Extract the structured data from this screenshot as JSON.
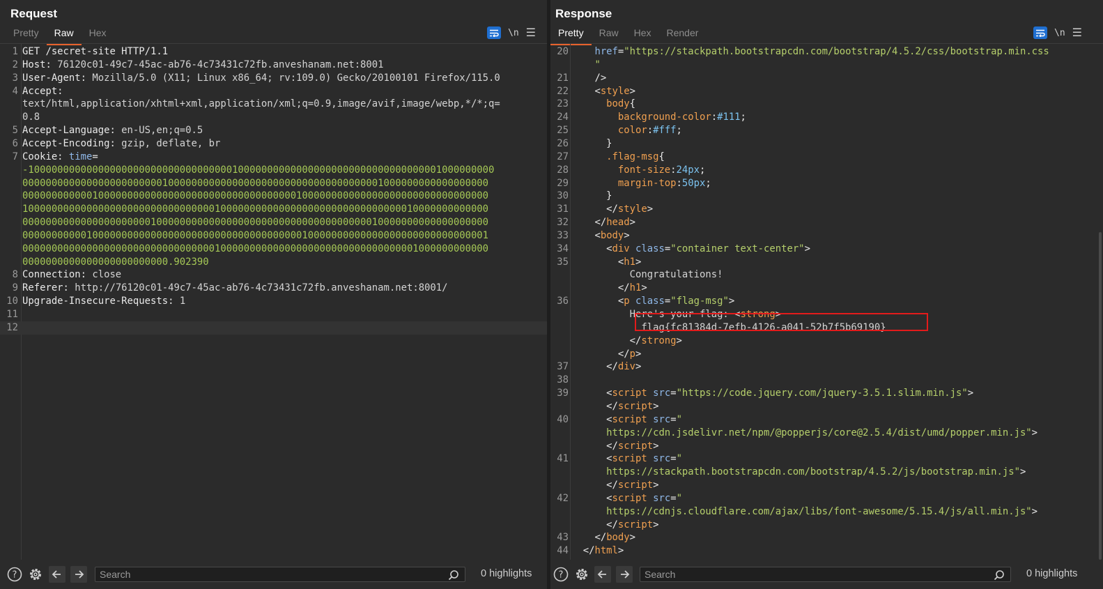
{
  "request": {
    "title": "Request",
    "tabs": [
      {
        "label": "Pretty"
      },
      {
        "label": "Raw"
      },
      {
        "label": "Hex"
      }
    ],
    "active_tab": "Raw",
    "newline_label": "\\n",
    "lines": [
      {
        "n": "1",
        "parts": [
          {
            "c": "k",
            "t": "GET /secret-site HTTP/1.1"
          }
        ]
      },
      {
        "n": "2",
        "parts": [
          {
            "c": "k",
            "t": "Host: "
          },
          {
            "c": "v",
            "t": "76120c01-49c7-45ac-ab76-4c73431c72fb.anveshanam.net:8001"
          }
        ]
      },
      {
        "n": "3",
        "parts": [
          {
            "c": "k",
            "t": "User-Agent: "
          },
          {
            "c": "v",
            "t": "Mozilla/5.0 (X11; Linux x86_64; rv:109.0) Gecko/20100101 Firefox/115.0"
          }
        ]
      },
      {
        "n": "4",
        "parts": [
          {
            "c": "k",
            "t": "Accept: "
          }
        ]
      },
      {
        "n": "",
        "parts": [
          {
            "c": "v",
            "t": "text/html,application/xhtml+xml,application/xml;q=0.9,image/avif,image/webp,*/*;q="
          }
        ]
      },
      {
        "n": "",
        "parts": [
          {
            "c": "v",
            "t": "0.8"
          }
        ]
      },
      {
        "n": "5",
        "parts": [
          {
            "c": "k",
            "t": "Accept-Language: "
          },
          {
            "c": "v",
            "t": "en-US,en;q=0.5"
          }
        ]
      },
      {
        "n": "6",
        "parts": [
          {
            "c": "k",
            "t": "Accept-Encoding: "
          },
          {
            "c": "v",
            "t": "gzip, deflate, br"
          }
        ]
      },
      {
        "n": "7",
        "parts": [
          {
            "c": "k",
            "t": "Cookie: "
          },
          {
            "c": "a",
            "t": "time"
          },
          {
            "c": "k",
            "t": "="
          }
        ]
      },
      {
        "n": "",
        "parts": [
          {
            "c": "g",
            "t": "-10000000000000000000000000000000000100000000000000000000000000000000001000000000"
          }
        ]
      },
      {
        "n": "",
        "parts": [
          {
            "c": "g",
            "t": "00000000000000000000000010000000000000000000000000000000000001000000000000000000"
          }
        ]
      },
      {
        "n": "",
        "parts": [
          {
            "c": "g",
            "t": "00000000000010000000000000000000000000000000000100000000000000000000000000000000"
          }
        ]
      },
      {
        "n": "",
        "parts": [
          {
            "c": "g",
            "t": "10000000000000000000000000000000010000000000000000000000000000000010000000000000"
          }
        ]
      },
      {
        "n": "",
        "parts": [
          {
            "c": "g",
            "t": "00000000000000000000001000000000000000000000000000000000000010000000000000000000"
          }
        ]
      },
      {
        "n": "",
        "parts": [
          {
            "c": "g",
            "t": "00000000000100000000000000000000000000000000000010000000000000000000000000000001"
          }
        ]
      },
      {
        "n": "",
        "parts": [
          {
            "c": "g",
            "t": "00000000000000000000000000000000010000000000000000000000000000000001000000000000"
          }
        ]
      },
      {
        "n": "",
        "parts": [
          {
            "c": "g",
            "t": "0000000000000000000000000.902390"
          }
        ]
      },
      {
        "n": "8",
        "parts": [
          {
            "c": "k",
            "t": "Connection: "
          },
          {
            "c": "v",
            "t": "close"
          }
        ]
      },
      {
        "n": "9",
        "parts": [
          {
            "c": "k",
            "t": "Referer: "
          },
          {
            "c": "v",
            "t": "http://76120c01-49c7-45ac-ab76-4c73431c72fb.anveshanam.net:8001/"
          }
        ]
      },
      {
        "n": "10",
        "parts": [
          {
            "c": "k",
            "t": "Upgrade-Insecure-Requests: "
          },
          {
            "c": "v",
            "t": "1"
          }
        ]
      },
      {
        "n": "11",
        "parts": []
      },
      {
        "n": "12",
        "parts": []
      }
    ],
    "search_placeholder": "Search",
    "highlights": "0 highlights"
  },
  "response": {
    "title": "Response",
    "tabs": [
      {
        "label": "Pretty"
      },
      {
        "label": "Raw"
      },
      {
        "label": "Hex"
      },
      {
        "label": "Render"
      }
    ],
    "active_tab": "Pretty",
    "newline_label": "\\n",
    "lines": [
      {
        "n": "20",
        "parts": [
          {
            "c": "a",
            "t": "    href"
          },
          {
            "c": "p",
            "t": "="
          },
          {
            "c": "s",
            "t": "\"https://stackpath.bootstrapcdn.com/bootstrap/4.5.2/css/bootstrap.min.css"
          }
        ]
      },
      {
        "n": "",
        "parts": [
          {
            "c": "s",
            "t": "    \""
          }
        ]
      },
      {
        "n": "21",
        "parts": [
          {
            "c": "t",
            "t": "    />"
          }
        ]
      },
      {
        "n": "22",
        "parts": [
          {
            "c": "t",
            "t": "    <"
          },
          {
            "c": "tn",
            "t": "style"
          },
          {
            "c": "t",
            "t": ">"
          }
        ]
      },
      {
        "n": "23",
        "parts": [
          {
            "c": "sel",
            "t": "      body"
          },
          {
            "c": "p",
            "t": "{"
          }
        ]
      },
      {
        "n": "24",
        "parts": [
          {
            "c": "prop",
            "t": "        background-color"
          },
          {
            "c": "p",
            "t": ":"
          },
          {
            "c": "num",
            "t": "#111"
          },
          {
            "c": "p",
            "t": ";"
          }
        ]
      },
      {
        "n": "25",
        "parts": [
          {
            "c": "prop",
            "t": "        color"
          },
          {
            "c": "p",
            "t": ":"
          },
          {
            "c": "num",
            "t": "#fff"
          },
          {
            "c": "p",
            "t": ";"
          }
        ]
      },
      {
        "n": "26",
        "parts": [
          {
            "c": "p",
            "t": "      }"
          }
        ]
      },
      {
        "n": "27",
        "parts": [
          {
            "c": "sel",
            "t": "      .flag-msg"
          },
          {
            "c": "p",
            "t": "{"
          }
        ]
      },
      {
        "n": "28",
        "parts": [
          {
            "c": "prop",
            "t": "        font-size"
          },
          {
            "c": "p",
            "t": ":"
          },
          {
            "c": "num",
            "t": "24px"
          },
          {
            "c": "p",
            "t": ";"
          }
        ]
      },
      {
        "n": "29",
        "parts": [
          {
            "c": "prop",
            "t": "        margin-top"
          },
          {
            "c": "p",
            "t": ":"
          },
          {
            "c": "num",
            "t": "50px"
          },
          {
            "c": "p",
            "t": ";"
          }
        ]
      },
      {
        "n": "30",
        "parts": [
          {
            "c": "p",
            "t": "      }"
          }
        ]
      },
      {
        "n": "31",
        "parts": [
          {
            "c": "t",
            "t": "      </"
          },
          {
            "c": "tn",
            "t": "style"
          },
          {
            "c": "t",
            "t": ">"
          }
        ]
      },
      {
        "n": "32",
        "parts": [
          {
            "c": "t",
            "t": "    </"
          },
          {
            "c": "tn",
            "t": "head"
          },
          {
            "c": "t",
            "t": ">"
          }
        ]
      },
      {
        "n": "33",
        "parts": [
          {
            "c": "t",
            "t": "    <"
          },
          {
            "c": "tn",
            "t": "body"
          },
          {
            "c": "t",
            "t": ">"
          }
        ]
      },
      {
        "n": "34",
        "parts": [
          {
            "c": "t",
            "t": "      <"
          },
          {
            "c": "tn",
            "t": "div"
          },
          {
            "c": "a",
            "t": " class"
          },
          {
            "c": "p",
            "t": "="
          },
          {
            "c": "s",
            "t": "\"container text-center\""
          },
          {
            "c": "t",
            "t": ">"
          }
        ]
      },
      {
        "n": "35",
        "parts": [
          {
            "c": "t",
            "t": "        <"
          },
          {
            "c": "tn",
            "t": "h1"
          },
          {
            "c": "t",
            "t": ">"
          }
        ]
      },
      {
        "n": "",
        "parts": [
          {
            "c": "v",
            "t": "          Congratulations!"
          }
        ]
      },
      {
        "n": "",
        "parts": [
          {
            "c": "t",
            "t": "        </"
          },
          {
            "c": "tn",
            "t": "h1"
          },
          {
            "c": "t",
            "t": ">"
          }
        ]
      },
      {
        "n": "36",
        "parts": [
          {
            "c": "t",
            "t": "        <"
          },
          {
            "c": "tn",
            "t": "p"
          },
          {
            "c": "a",
            "t": " class"
          },
          {
            "c": "p",
            "t": "="
          },
          {
            "c": "s",
            "t": "\"flag-msg\""
          },
          {
            "c": "t",
            "t": ">"
          }
        ]
      },
      {
        "n": "",
        "parts": [
          {
            "c": "v",
            "t": "          Here's your flag: "
          },
          {
            "c": "t",
            "t": "<"
          },
          {
            "c": "tn",
            "t": "strong"
          },
          {
            "c": "t",
            "t": ">"
          }
        ]
      },
      {
        "n": "",
        "parts": [
          {
            "c": "v",
            "t": "            flag{fc81384d-7efb-4126-a041-52b7f5b69190}"
          }
        ]
      },
      {
        "n": "",
        "parts": [
          {
            "c": "t",
            "t": "          </"
          },
          {
            "c": "tn",
            "t": "strong"
          },
          {
            "c": "t",
            "t": ">"
          }
        ]
      },
      {
        "n": "",
        "parts": [
          {
            "c": "t",
            "t": "        </"
          },
          {
            "c": "tn",
            "t": "p"
          },
          {
            "c": "t",
            "t": ">"
          }
        ]
      },
      {
        "n": "37",
        "parts": [
          {
            "c": "t",
            "t": "      </"
          },
          {
            "c": "tn",
            "t": "div"
          },
          {
            "c": "t",
            "t": ">"
          }
        ]
      },
      {
        "n": "38",
        "parts": []
      },
      {
        "n": "39",
        "parts": [
          {
            "c": "t",
            "t": "      <"
          },
          {
            "c": "tn",
            "t": "script"
          },
          {
            "c": "a",
            "t": " src"
          },
          {
            "c": "p",
            "t": "="
          },
          {
            "c": "s",
            "t": "\"https://code.jquery.com/jquery-3.5.1.slim.min.js\""
          },
          {
            "c": "t",
            "t": ">"
          }
        ]
      },
      {
        "n": "",
        "parts": [
          {
            "c": "t",
            "t": "      </"
          },
          {
            "c": "tn",
            "t": "script"
          },
          {
            "c": "t",
            "t": ">"
          }
        ]
      },
      {
        "n": "40",
        "parts": [
          {
            "c": "t",
            "t": "      <"
          },
          {
            "c": "tn",
            "t": "script"
          },
          {
            "c": "a",
            "t": " src"
          },
          {
            "c": "p",
            "t": "="
          },
          {
            "c": "s",
            "t": "\""
          }
        ]
      },
      {
        "n": "",
        "parts": [
          {
            "c": "s",
            "t": "      https://cdn.jsdelivr.net/npm/@popperjs/core@2.5.4/dist/umd/popper.min.js\""
          },
          {
            "c": "t",
            "t": ">"
          }
        ]
      },
      {
        "n": "",
        "parts": [
          {
            "c": "t",
            "t": "      </"
          },
          {
            "c": "tn",
            "t": "script"
          },
          {
            "c": "t",
            "t": ">"
          }
        ]
      },
      {
        "n": "41",
        "parts": [
          {
            "c": "t",
            "t": "      <"
          },
          {
            "c": "tn",
            "t": "script"
          },
          {
            "c": "a",
            "t": " src"
          },
          {
            "c": "p",
            "t": "="
          },
          {
            "c": "s",
            "t": "\""
          }
        ]
      },
      {
        "n": "",
        "parts": [
          {
            "c": "s",
            "t": "      https://stackpath.bootstrapcdn.com/bootstrap/4.5.2/js/bootstrap.min.js\""
          },
          {
            "c": "t",
            "t": ">"
          }
        ]
      },
      {
        "n": "",
        "parts": [
          {
            "c": "t",
            "t": "      </"
          },
          {
            "c": "tn",
            "t": "script"
          },
          {
            "c": "t",
            "t": ">"
          }
        ]
      },
      {
        "n": "42",
        "parts": [
          {
            "c": "t",
            "t": "      <"
          },
          {
            "c": "tn",
            "t": "script"
          },
          {
            "c": "a",
            "t": " src"
          },
          {
            "c": "p",
            "t": "="
          },
          {
            "c": "s",
            "t": "\""
          }
        ]
      },
      {
        "n": "",
        "parts": [
          {
            "c": "s",
            "t": "      https://cdnjs.cloudflare.com/ajax/libs/font-awesome/5.15.4/js/all.min.js\""
          },
          {
            "c": "t",
            "t": ">"
          }
        ]
      },
      {
        "n": "",
        "parts": [
          {
            "c": "t",
            "t": "      </"
          },
          {
            "c": "tn",
            "t": "script"
          },
          {
            "c": "t",
            "t": ">"
          }
        ]
      },
      {
        "n": "43",
        "parts": [
          {
            "c": "t",
            "t": "    </"
          },
          {
            "c": "tn",
            "t": "body"
          },
          {
            "c": "t",
            "t": ">"
          }
        ]
      },
      {
        "n": "44",
        "parts": [
          {
            "c": "t",
            "t": "  </"
          },
          {
            "c": "tn",
            "t": "html"
          },
          {
            "c": "t",
            "t": ">"
          }
        ]
      }
    ],
    "search_placeholder": "Search",
    "highlights": "0 highlights"
  },
  "colors": {
    "accent_tab": "#e8622c",
    "flag_box": "#e31b1b",
    "wrap_button": "#1f6fd1"
  },
  "icons": [
    "help-icon",
    "gear-icon",
    "arrow-left-icon",
    "arrow-right-icon",
    "search-icon",
    "wrap-lines-icon",
    "menu-icon",
    "layout-split-icon"
  ]
}
